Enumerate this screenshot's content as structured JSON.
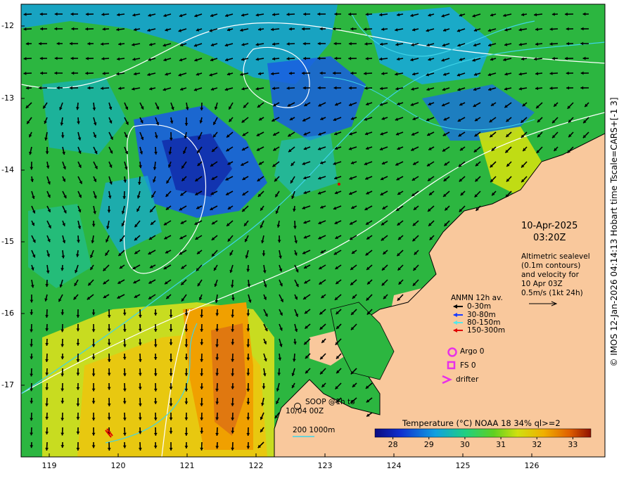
{
  "y_ticks": [
    "-12",
    "-13",
    "-14",
    "-15",
    "-16",
    "-17"
  ],
  "x_ticks": [
    "119",
    "120",
    "121",
    "122",
    "123",
    "124",
    "125",
    "126"
  ],
  "timestamp": {
    "date": "10-Apr-2025",
    "time": "03:20Z"
  },
  "altimetry_note": [
    "Altimetric sealevel",
    "(0.1m contours)",
    "and velocity for",
    "10 Apr 03Z",
    "0.5m/s (1kt 24h)"
  ],
  "anmn": {
    "title": "ANMN 12h av.",
    "items": [
      {
        "label": "0-30m",
        "color": "#000000"
      },
      {
        "label": "30-80m",
        "color": "#1a3cff"
      },
      {
        "label": "80-150m",
        "color": "#55e8e8"
      },
      {
        "label": "150-300m",
        "color": "#e00000"
      }
    ]
  },
  "symbols": {
    "argo": "Argo 0",
    "fs": "FS 0",
    "drifter": "drifter",
    "soop_line1": "SOOP @1h to",
    "soop_line2": "10/04 00Z"
  },
  "contour_legend": {
    "label": "200  1000m",
    "color": "#3fd4e8"
  },
  "colorbar": {
    "title": "Temperature (°C) NOAA 18 34% ql>=2",
    "ticks": [
      "28",
      "29",
      "30",
      "31",
      "32",
      "33"
    ],
    "min": 27.5,
    "max": 33.5
  },
  "credit": "© IMOS 12-Jan-2026 04:14:13 Hobart time Tscale=CARS+[-1 3]",
  "colors": {
    "land": "#f9c89c",
    "arrow": "#000000",
    "argo": "#e830e8"
  }
}
